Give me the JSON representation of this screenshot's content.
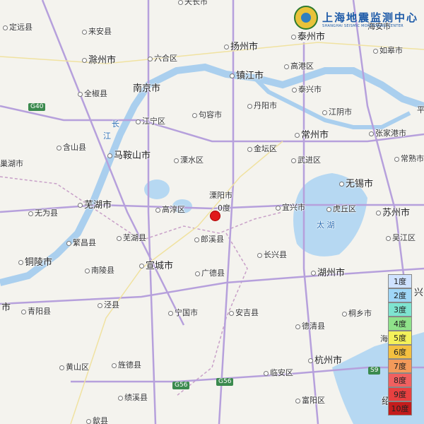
{
  "map": {
    "labels": {
      "tianchang": "天长市",
      "taizhou": "泰州市",
      "haian": "海安市",
      "dingyuan": "定远县",
      "laian": "来安县",
      "rugao": "如皋市",
      "chuzhou": "滁州市",
      "liuhe": "六合区",
      "yangzhou": "扬州市",
      "gaogang": "高港区",
      "zhenjiang": "镇江市",
      "nanjing": "南京市",
      "quanjiao": "全椒县",
      "taixing": "泰兴市",
      "jurong": "句容市",
      "danyang": "丹阳市",
      "jiangyin": "江阴市",
      "jiangning": "江宁区",
      "hanshan": "含山县",
      "zhangjiagang": "张家港市",
      "changzhou": "常州市",
      "maanshan": "马鞍山市",
      "jintan": "金坛区",
      "lishui": "溧水区",
      "wujin": "武进区",
      "chaohu": "巢湖市",
      "changshu": "常熟市",
      "liyang": "溧阳市",
      "wuxi": "无锡市",
      "wuhu": "芜湖市",
      "gaochun": "高淳区",
      "yixing": "宜兴市",
      "huqiu": "虎丘区",
      "suzhou": "苏州市",
      "wuwei": "无为县",
      "taihu": "太 湖",
      "wuhuxian": "芜湖县",
      "langxi": "郎溪县",
      "wujiang": "吴江区",
      "fanchang": "繁昌县",
      "changxing": "长兴县",
      "tongling": "铜陵市",
      "xuancheng": "宣城市",
      "nanling": "南陵县",
      "guangde": "广德县",
      "huzhou": "湖州市",
      "chizhou_shi": "市",
      "qingyang": "青阳县",
      "jingxian": "泾县",
      "ningguo": "宁国市",
      "anji": "安吉县",
      "tongxiang": "桐乡市",
      "deqing": "德清县",
      "haining": "海",
      "huangshan": "黄山区",
      "jingde": "旌德县",
      "hangzhou": "杭州市",
      "linan": "临安区",
      "jixi": "绩溪县",
      "fuyang": "富阳区",
      "shexian": "歙县",
      "shaoxing": "绍",
      "xing": "兴",
      "chang": "长",
      "jiang": "江",
      "ping": "平"
    },
    "roads": {
      "g40": "G40",
      "g56a": "G56",
      "g56b": "G56",
      "s9": "S9"
    },
    "epicenter_label": "0度",
    "logo": {
      "title": "上海地震监测中心",
      "subtitle": "SHANGHAI SEISMIC MONITORING CENTER"
    },
    "legend": [
      {
        "label": "1度",
        "color": "#cfe2ff"
      },
      {
        "label": "2度",
        "color": "#9fd6f7"
      },
      {
        "label": "3度",
        "color": "#7ee4d0"
      },
      {
        "label": "4度",
        "color": "#8fe28a"
      },
      {
        "label": "5度",
        "color": "#f4f15a"
      },
      {
        "label": "6度",
        "color": "#f4c040"
      },
      {
        "label": "7度",
        "color": "#f39a5a"
      },
      {
        "label": "8度",
        "color": "#f06060"
      },
      {
        "label": "9度",
        "color": "#e84040"
      },
      {
        "label": "10度",
        "color": "#c41c1c"
      }
    ]
  }
}
